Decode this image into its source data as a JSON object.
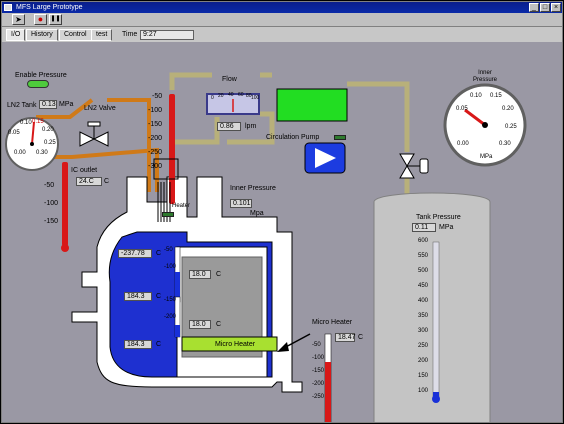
{
  "window": {
    "title": "MFS Large Prototype"
  },
  "toolbar": {
    "run_glyph": "➤",
    "stop_glyph": "●",
    "pause_glyph": "❚❚"
  },
  "tabs": [
    {
      "label": "I/O",
      "active": true
    },
    {
      "label": "History",
      "active": false
    },
    {
      "label": "Control",
      "active": false
    },
    {
      "label": "test",
      "active": false
    }
  ],
  "time": {
    "label": "Time",
    "value": "9:27"
  },
  "enable_pressure": {
    "label": "Enable Pressure",
    "led_color": "#4ecb3c"
  },
  "ln2_tank": {
    "label": "LN2 Tank",
    "value": "0.13",
    "unit": "MPa",
    "ticks": [
      "0.05",
      "0.10",
      "0.15",
      "0.20",
      "0.25",
      "0.30",
      "0.00"
    ]
  },
  "ln2_valve": {
    "label": "LN2 Valve"
  },
  "ic_outlet": {
    "label": "IC outlet",
    "value": "24.C",
    "unit": "C",
    "ticks": [
      "-50",
      "-100",
      "-150"
    ]
  },
  "flow": {
    "label": "Flow",
    "gauge_ticks": [
      "0",
      "20",
      "40",
      "60",
      "80",
      "100"
    ],
    "value": "0.86",
    "unit": "lpm"
  },
  "circulation_pump": {
    "label": "Circulation Pump",
    "led_color": "#2e7a2e"
  },
  "pump_tc": {
    "ticks": [
      "-50",
      "-100",
      "-150",
      "-200",
      "-250",
      "-300"
    ]
  },
  "inner_pressure": {
    "label": "Inner Pressure",
    "value": "0.101",
    "unit": "Mpa"
  },
  "heater": {
    "label": "Heater",
    "led_color": "#2e7a2e"
  },
  "temps": [
    {
      "value": "-237.78",
      "unit": "C"
    },
    {
      "value": "184.3",
      "unit": "C"
    },
    {
      "value": "184.3",
      "unit": "C"
    },
    {
      "value": "18.0",
      "unit": "C"
    },
    {
      "value": "18.0",
      "unit": "C"
    }
  ],
  "side_thermos": {
    "ticks": [
      "-50",
      "-100",
      "-150",
      "-200"
    ]
  },
  "micro_heater": {
    "label": "Micro Heater"
  },
  "micro_heater_tc": {
    "label": "Micro Heater",
    "value": "18.47",
    "unit": "C",
    "ticks": [
      "-50",
      "-100",
      "-150",
      "-200",
      "-250"
    ]
  },
  "inner_gauge": {
    "label": "Inner Pressure",
    "unit": "MPa",
    "ticks": [
      "0.05",
      "0.10",
      "0.15",
      "0.20",
      "0.25",
      "0.30",
      "0.00"
    ]
  },
  "tank_pressure": {
    "label": "Tank Pressure",
    "value": "0.11",
    "unit": "MPa",
    "ticks": [
      "100",
      "150",
      "200",
      "250",
      "300",
      "350",
      "400",
      "450",
      "500",
      "550",
      "600"
    ]
  },
  "colors": {
    "pipe": "#d07a18",
    "gas_pipe": "#b8b07a",
    "vessel": "#ffffff",
    "liquid": "#2030d8",
    "flow_box": "#22dd22",
    "pump": "#1c3ce0",
    "thermo_red": "#d81818",
    "thermo_blue": "#1830d8"
  }
}
